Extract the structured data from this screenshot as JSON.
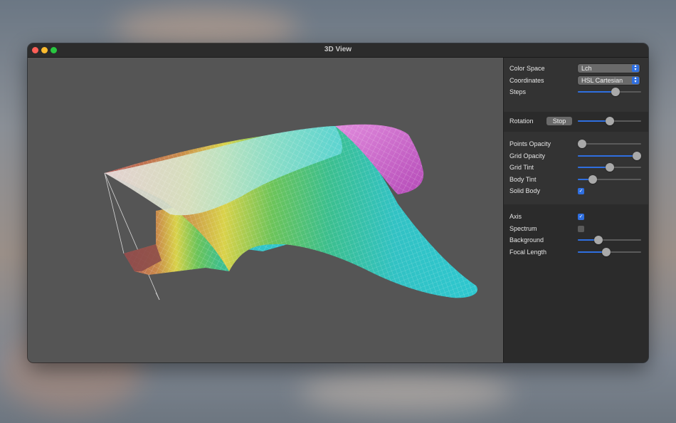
{
  "window": {
    "title": "3D View"
  },
  "controls": {
    "color_space": {
      "label": "Color Space",
      "value": "Lch"
    },
    "coordinates": {
      "label": "Coordinates",
      "value": "HSL Cartesian"
    },
    "steps": {
      "label": "Steps",
      "value": 0.6
    },
    "rotation": {
      "label": "Rotation",
      "button": "Stop",
      "value": 0.5
    },
    "points_opacity": {
      "label": "Points Opacity",
      "value": 0.07
    },
    "grid_opacity": {
      "label": "Grid Opacity",
      "value": 0.93
    },
    "grid_tint": {
      "label": "Grid Tint",
      "value": 0.5
    },
    "body_tint": {
      "label": "Body Tint",
      "value": 0.24
    },
    "solid_body": {
      "label": "Solid Body",
      "checked": true
    },
    "axis": {
      "label": "Axis",
      "checked": true
    },
    "spectrum": {
      "label": "Spectrum",
      "checked": false
    },
    "background": {
      "label": "Background",
      "value": 0.33
    },
    "focal_length": {
      "label": "Focal Length",
      "value": 0.45
    }
  },
  "icons": {
    "checkmark": "✓",
    "popup_chevron": "chevron-up-down-icon"
  },
  "colors": {
    "accent": "#2f6fe0",
    "viewport_bg": "#555555",
    "panel_bg": "#2b2b2b"
  }
}
